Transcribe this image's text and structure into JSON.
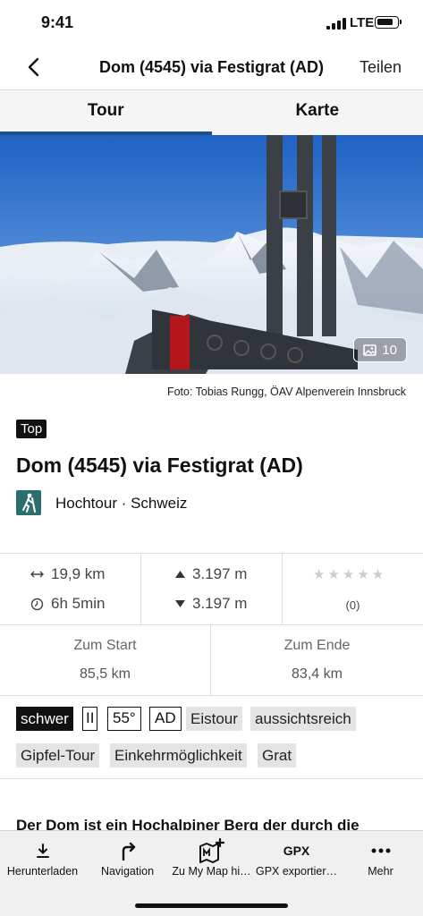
{
  "status_bar": {
    "time": "9:41",
    "network": "LTE"
  },
  "navbar": {
    "title": "Dom (4545) via Festigrat (AD)",
    "share_label": "Teilen"
  },
  "tabs": [
    {
      "label": "Tour",
      "active": true
    },
    {
      "label": "Karte",
      "active": false
    }
  ],
  "hero": {
    "photo_count": "10",
    "caption": "Foto: Tobias Rungg, ÖAV Alpenverein Innsbruck"
  },
  "badge": "Top",
  "title": "Dom (4545) via Festigrat (AD)",
  "category": {
    "icon": "hiking-icon",
    "text": "Hochtour · Schweiz",
    "color": "#2a6e6e"
  },
  "stats": {
    "distance": "19,9 km",
    "duration": "6h 5min",
    "ascent": "3.197 m",
    "descent": "3.197 m",
    "rating_stars": 0,
    "rating_count": "(0)",
    "to_start_label": "Zum Start",
    "to_start_value": "85,5 km",
    "to_end_label": "Zum Ende",
    "to_end_value": "83,4 km"
  },
  "tags": [
    "schwer",
    "II",
    "55°",
    "AD",
    "Eistour",
    "aussichtsreich",
    "Gipfel-Tour",
    "Einkehrmöglichkeit",
    "Grat"
  ],
  "description_start": "Der Dom ist ein Hochalpiner Berg der durch die",
  "toolbar": [
    {
      "label": "Herunterladen",
      "icon": "download-icon"
    },
    {
      "label": "Navigation",
      "icon": "turn-right-icon"
    },
    {
      "label": "Zu My Map hi…",
      "icon": "my-map-add-icon"
    },
    {
      "label": "GPX exportier…",
      "icon": "gpx-icon",
      "icon_text": "GPX"
    },
    {
      "label": "Mehr",
      "icon": "more-icon"
    }
  ],
  "colors": {
    "accent": "#1d4f8f",
    "tag_dark": "#111111",
    "tag_grey": "#e4e4e4"
  }
}
